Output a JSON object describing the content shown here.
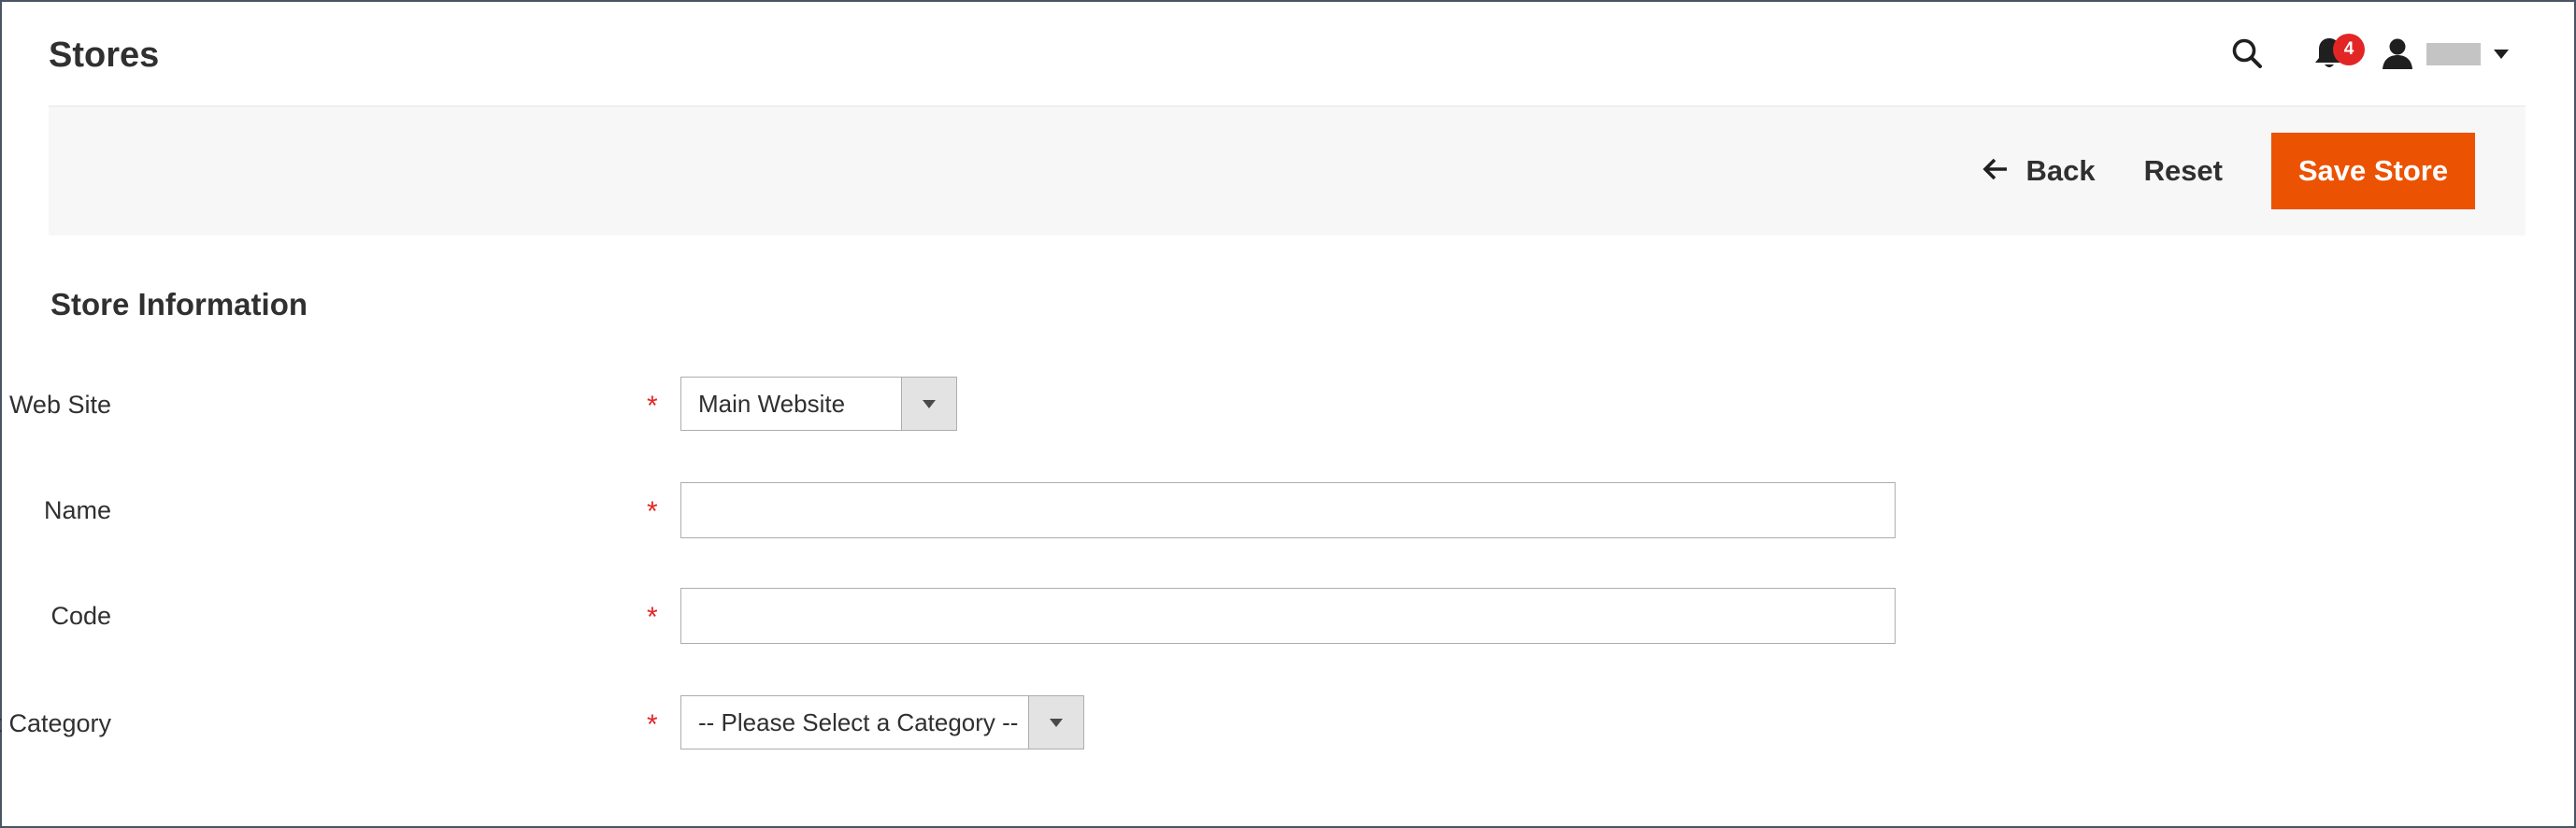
{
  "header": {
    "title": "Stores",
    "notifications_count": "4",
    "icons": {
      "search": "search-icon",
      "notifications": "bell-icon",
      "user": "user-icon",
      "dropdown": "caret-down-icon"
    }
  },
  "actions": {
    "back_label": "Back",
    "reset_label": "Reset",
    "save_label": "Save Store"
  },
  "section": {
    "title": "Store Information"
  },
  "form": {
    "website": {
      "label": "Web Site",
      "value": "Main Website",
      "required": true
    },
    "name": {
      "label": "Name",
      "value": "",
      "required": true
    },
    "code": {
      "label": "Code",
      "value": "",
      "required": true
    },
    "root_category": {
      "label": "Root Category",
      "value": "-- Please Select a Category --",
      "required": true
    },
    "required_marker": "*"
  },
  "colors": {
    "accent": "#eb5202",
    "badge": "#e22626",
    "required": "#e22626",
    "action_bar_bg": "#f7f7f7",
    "text": "#303030"
  }
}
